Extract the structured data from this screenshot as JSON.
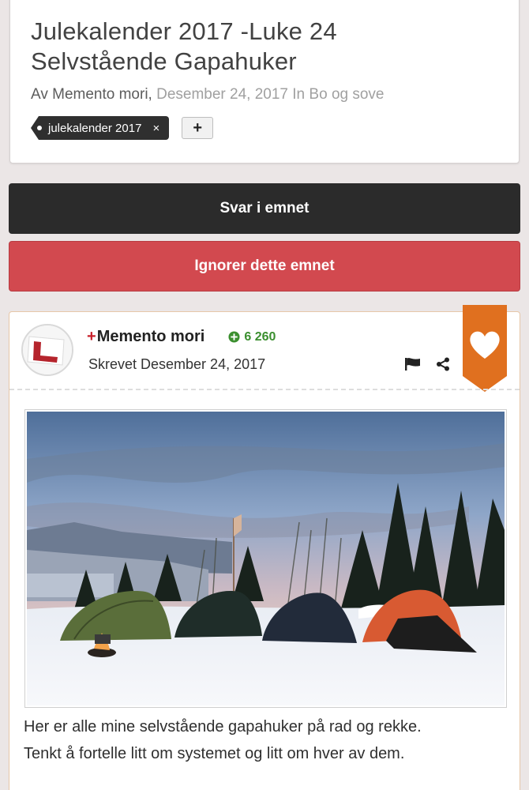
{
  "topic": {
    "title_line1": "Julekalender 2017 -Luke 24",
    "title_line2": "Selvstående Gapahuker",
    "by_prefix": "Av",
    "author": "Memento mori,",
    "date": "Desember 24, 2017",
    "in_word": "In",
    "category": "Bo og sove",
    "tag_label": "julekalender 2017",
    "tag_remove": "×",
    "add_tag": "+"
  },
  "buttons": {
    "reply": "Svar i emnet",
    "ignore": "Ignorer dette emnet"
  },
  "post": {
    "author_plus": "+",
    "author_name": "Memento mori",
    "reputation": "6 260",
    "posted": "Skrevet Desember 24, 2017",
    "body_line1": "Her er alle mine selvstående gapahuker på rad og rekke.",
    "body_line2": "Tenkt å fortelle litt om systemet og litt om hver av dem."
  },
  "colors": {
    "background": "#ebe6e6",
    "reply_button": "#2b2b2b",
    "ignore_button": "#d2494f",
    "reaction_ribbon": "#e0701f",
    "reputation": "#3b8f2f",
    "post_border": "#e7c7a8"
  },
  "icons": {
    "tag": "tag-dot-icon",
    "remove": "close-icon",
    "add": "plus-icon",
    "reputation": "plus-circle-icon",
    "report": "flag-icon",
    "share": "share-icon",
    "reaction": "heart-icon",
    "avatar": "learner-L-plate-icon"
  }
}
